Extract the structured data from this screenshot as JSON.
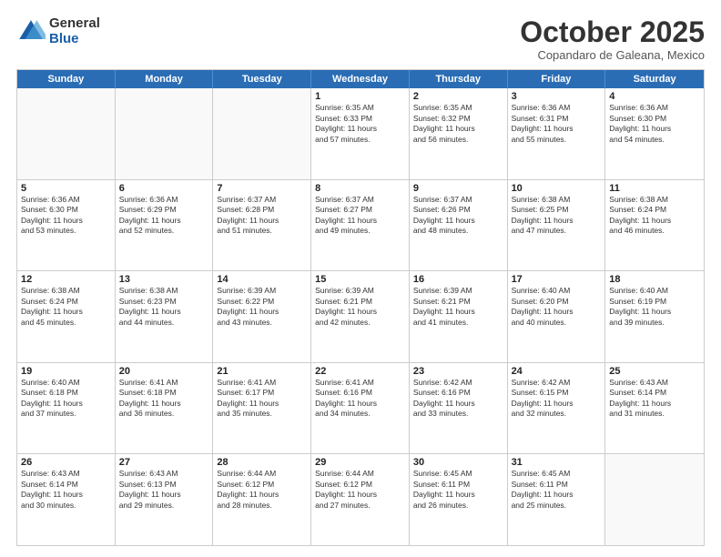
{
  "logo": {
    "general": "General",
    "blue": "Blue"
  },
  "header": {
    "month": "October 2025",
    "location": "Copandaro de Galeana, Mexico"
  },
  "days_of_week": [
    "Sunday",
    "Monday",
    "Tuesday",
    "Wednesday",
    "Thursday",
    "Friday",
    "Saturday"
  ],
  "weeks": [
    [
      {
        "day": "",
        "info": ""
      },
      {
        "day": "",
        "info": ""
      },
      {
        "day": "",
        "info": ""
      },
      {
        "day": "1",
        "info": "Sunrise: 6:35 AM\nSunset: 6:33 PM\nDaylight: 11 hours\nand 57 minutes."
      },
      {
        "day": "2",
        "info": "Sunrise: 6:35 AM\nSunset: 6:32 PM\nDaylight: 11 hours\nand 56 minutes."
      },
      {
        "day": "3",
        "info": "Sunrise: 6:36 AM\nSunset: 6:31 PM\nDaylight: 11 hours\nand 55 minutes."
      },
      {
        "day": "4",
        "info": "Sunrise: 6:36 AM\nSunset: 6:30 PM\nDaylight: 11 hours\nand 54 minutes."
      }
    ],
    [
      {
        "day": "5",
        "info": "Sunrise: 6:36 AM\nSunset: 6:30 PM\nDaylight: 11 hours\nand 53 minutes."
      },
      {
        "day": "6",
        "info": "Sunrise: 6:36 AM\nSunset: 6:29 PM\nDaylight: 11 hours\nand 52 minutes."
      },
      {
        "day": "7",
        "info": "Sunrise: 6:37 AM\nSunset: 6:28 PM\nDaylight: 11 hours\nand 51 minutes."
      },
      {
        "day": "8",
        "info": "Sunrise: 6:37 AM\nSunset: 6:27 PM\nDaylight: 11 hours\nand 49 minutes."
      },
      {
        "day": "9",
        "info": "Sunrise: 6:37 AM\nSunset: 6:26 PM\nDaylight: 11 hours\nand 48 minutes."
      },
      {
        "day": "10",
        "info": "Sunrise: 6:38 AM\nSunset: 6:25 PM\nDaylight: 11 hours\nand 47 minutes."
      },
      {
        "day": "11",
        "info": "Sunrise: 6:38 AM\nSunset: 6:24 PM\nDaylight: 11 hours\nand 46 minutes."
      }
    ],
    [
      {
        "day": "12",
        "info": "Sunrise: 6:38 AM\nSunset: 6:24 PM\nDaylight: 11 hours\nand 45 minutes."
      },
      {
        "day": "13",
        "info": "Sunrise: 6:38 AM\nSunset: 6:23 PM\nDaylight: 11 hours\nand 44 minutes."
      },
      {
        "day": "14",
        "info": "Sunrise: 6:39 AM\nSunset: 6:22 PM\nDaylight: 11 hours\nand 43 minutes."
      },
      {
        "day": "15",
        "info": "Sunrise: 6:39 AM\nSunset: 6:21 PM\nDaylight: 11 hours\nand 42 minutes."
      },
      {
        "day": "16",
        "info": "Sunrise: 6:39 AM\nSunset: 6:21 PM\nDaylight: 11 hours\nand 41 minutes."
      },
      {
        "day": "17",
        "info": "Sunrise: 6:40 AM\nSunset: 6:20 PM\nDaylight: 11 hours\nand 40 minutes."
      },
      {
        "day": "18",
        "info": "Sunrise: 6:40 AM\nSunset: 6:19 PM\nDaylight: 11 hours\nand 39 minutes."
      }
    ],
    [
      {
        "day": "19",
        "info": "Sunrise: 6:40 AM\nSunset: 6:18 PM\nDaylight: 11 hours\nand 37 minutes."
      },
      {
        "day": "20",
        "info": "Sunrise: 6:41 AM\nSunset: 6:18 PM\nDaylight: 11 hours\nand 36 minutes."
      },
      {
        "day": "21",
        "info": "Sunrise: 6:41 AM\nSunset: 6:17 PM\nDaylight: 11 hours\nand 35 minutes."
      },
      {
        "day": "22",
        "info": "Sunrise: 6:41 AM\nSunset: 6:16 PM\nDaylight: 11 hours\nand 34 minutes."
      },
      {
        "day": "23",
        "info": "Sunrise: 6:42 AM\nSunset: 6:16 PM\nDaylight: 11 hours\nand 33 minutes."
      },
      {
        "day": "24",
        "info": "Sunrise: 6:42 AM\nSunset: 6:15 PM\nDaylight: 11 hours\nand 32 minutes."
      },
      {
        "day": "25",
        "info": "Sunrise: 6:43 AM\nSunset: 6:14 PM\nDaylight: 11 hours\nand 31 minutes."
      }
    ],
    [
      {
        "day": "26",
        "info": "Sunrise: 6:43 AM\nSunset: 6:14 PM\nDaylight: 11 hours\nand 30 minutes."
      },
      {
        "day": "27",
        "info": "Sunrise: 6:43 AM\nSunset: 6:13 PM\nDaylight: 11 hours\nand 29 minutes."
      },
      {
        "day": "28",
        "info": "Sunrise: 6:44 AM\nSunset: 6:12 PM\nDaylight: 11 hours\nand 28 minutes."
      },
      {
        "day": "29",
        "info": "Sunrise: 6:44 AM\nSunset: 6:12 PM\nDaylight: 11 hours\nand 27 minutes."
      },
      {
        "day": "30",
        "info": "Sunrise: 6:45 AM\nSunset: 6:11 PM\nDaylight: 11 hours\nand 26 minutes."
      },
      {
        "day": "31",
        "info": "Sunrise: 6:45 AM\nSunset: 6:11 PM\nDaylight: 11 hours\nand 25 minutes."
      },
      {
        "day": "",
        "info": ""
      }
    ]
  ]
}
